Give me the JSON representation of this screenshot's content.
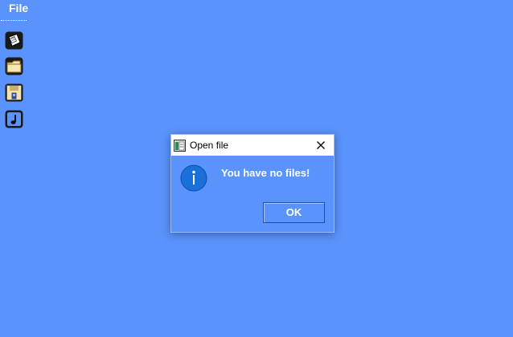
{
  "menu": {
    "file_label": "File"
  },
  "sidebar": {
    "icons": [
      {
        "name": "paper-notes-icon"
      },
      {
        "name": "folder-icon"
      },
      {
        "name": "floppy-disk-icon"
      },
      {
        "name": "music-note-icon"
      }
    ]
  },
  "dialog": {
    "title": "Open file",
    "message": "You have no files!",
    "ok_label": "OK",
    "icon": "info-icon"
  },
  "colors": {
    "desktop_background": "#5a93fb",
    "info_icon_fill": "#1b6fd8",
    "titlebar": "#ffffff"
  }
}
